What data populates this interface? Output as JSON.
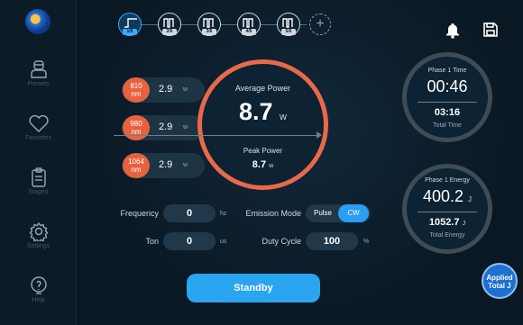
{
  "sidebar": {
    "items": [
      {
        "label": "Presets",
        "icon": "person-icon"
      },
      {
        "label": "Favorites",
        "icon": "heart-icon"
      },
      {
        "label": "Staged",
        "icon": "clipboard-icon"
      },
      {
        "label": "Settings",
        "icon": "gear-icon"
      },
      {
        "label": "Help",
        "icon": "bulb-icon"
      }
    ]
  },
  "phases": [
    {
      "badge": "1/6",
      "active": true
    },
    {
      "badge": "2/6",
      "active": false
    },
    {
      "badge": "3/6",
      "active": false
    },
    {
      "badge": "4/6",
      "active": false
    },
    {
      "badge": "5/6",
      "active": false
    }
  ],
  "wavelengths": [
    {
      "name": "810\nnm",
      "value": "2.9",
      "unit": "w"
    },
    {
      "name": "980\nnm",
      "value": "2.9",
      "unit": "w"
    },
    {
      "name": "1064\nnm",
      "value": "2.9",
      "unit": "w"
    }
  ],
  "power": {
    "avg_title": "Average Power",
    "avg_value": "8.7",
    "avg_unit": "w",
    "peak_title": "Peak Power",
    "peak_value": "8.7",
    "peak_unit": "w"
  },
  "controls": {
    "frequency_label": "Frequency",
    "frequency_value": "0",
    "frequency_unit": "hz",
    "ton_label": "Ton",
    "ton_value": "0",
    "ton_unit": "us",
    "emission_label": "Emission Mode",
    "pulse_label": "Pulse",
    "cw_label": "CW",
    "duty_label": "Duty Cycle",
    "duty_value": "100",
    "duty_unit": "%"
  },
  "time_gauge": {
    "title": "Phase 1 Time",
    "value": "00:46",
    "total_value": "03:16",
    "total_label": "Total Time"
  },
  "energy_gauge": {
    "title": "Phase 1 Energy",
    "value": "400.2",
    "unit": "J",
    "total_value": "1052.7",
    "total_unit": "J",
    "total_label": "Total Energy"
  },
  "standby_label": "Standby",
  "applied_label": "Applied\nTotal J",
  "colors": {
    "accent": "#2aa5f0",
    "laser": "#e8623f"
  }
}
